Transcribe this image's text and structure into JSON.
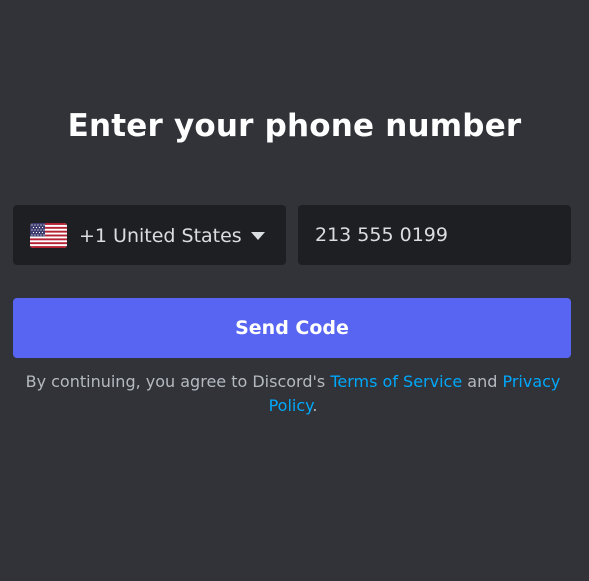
{
  "screen": {
    "title": "Enter your phone number"
  },
  "country_select": {
    "value": "+1 United States",
    "flag_icon": "us-flag-icon"
  },
  "phone_input": {
    "value": "213 555 0199"
  },
  "send_button": {
    "label": "Send Code"
  },
  "legal": {
    "prefix": "By continuing, you agree to Discord's ",
    "terms_link": "Terms of Service",
    "middle": " and ",
    "privacy_link": "Privacy Policy",
    "suffix": "."
  },
  "colors": {
    "background": "#313338",
    "input_background": "#1e1f22",
    "accent": "#5865f2",
    "link": "#00a8fc"
  }
}
